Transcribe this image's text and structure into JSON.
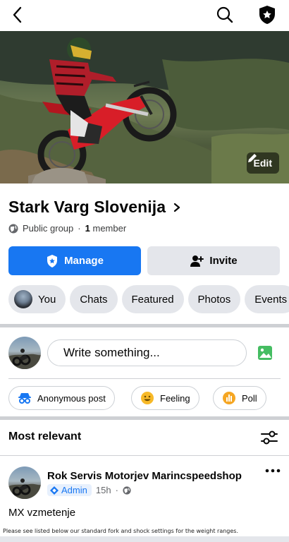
{
  "header": {
    "back_icon": "back-arrow-icon",
    "search_icon": "search-icon",
    "shield_icon": "admin-shield-icon"
  },
  "cover": {
    "edit_label": "Edit",
    "edit_icon": "pencil-icon"
  },
  "group": {
    "name": "Stark Varg Slovenija",
    "privacy": "Public group",
    "separator": "·",
    "member_count": "1",
    "member_label": "member"
  },
  "actions": {
    "manage_label": "Manage",
    "invite_label": "Invite"
  },
  "tabs": [
    {
      "label": "You"
    },
    {
      "label": "Chats"
    },
    {
      "label": "Featured"
    },
    {
      "label": "Photos"
    },
    {
      "label": "Events"
    }
  ],
  "composer": {
    "placeholder": "Write something...",
    "photo_icon": "photo-icon"
  },
  "post_options": [
    {
      "label": "Anonymous post",
      "icon": "anonymous-icon"
    },
    {
      "label": "Feeling",
      "icon": "feeling-emoji-icon"
    },
    {
      "label": "Poll",
      "icon": "poll-icon"
    }
  ],
  "feed": {
    "sort_label": "Most relevant",
    "filter_icon": "filter-sliders-icon"
  },
  "post": {
    "author": "Rok Servis Motorjev Marincspeedshop",
    "role": "Admin",
    "time": "15h",
    "separator": "·",
    "text": "MX vzmetenje",
    "preview": "Please see listed below our standard fork and shock settings for the weight ranges."
  },
  "colors": {
    "accent": "#1877f2",
    "chip_bg": "#e4e6eb",
    "photo_green": "#45bd62",
    "feeling_yellow": "#f7b928",
    "poll_orange": "#f5533d"
  }
}
